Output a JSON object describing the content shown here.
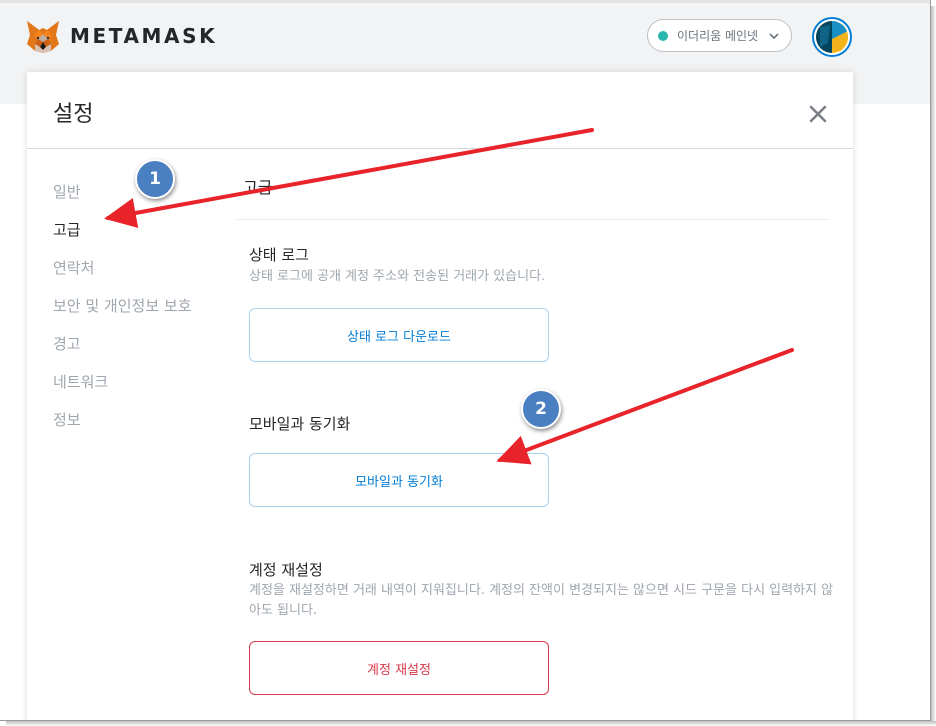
{
  "header": {
    "brand": "METAMASK",
    "network": "이더리움 메인넷"
  },
  "settings": {
    "title": "설정",
    "sidebar": [
      {
        "label": "일반",
        "active": false
      },
      {
        "label": "고급",
        "active": true
      },
      {
        "label": "연락처",
        "active": false
      },
      {
        "label": "보안 및 개인정보 보호",
        "active": false
      },
      {
        "label": "경고",
        "active": false
      },
      {
        "label": "네트워크",
        "active": false
      },
      {
        "label": "정보",
        "active": false
      }
    ],
    "section_title": "고급",
    "state_logs": {
      "label": "상태 로그",
      "description": "상태 로그에 공개 계정 주소와 전송된 거래가 있습니다.",
      "button": "상태 로그 다운로드"
    },
    "sync_mobile": {
      "label": "모바일과 동기화",
      "button": "모바일과 동기화"
    },
    "reset_account": {
      "label": "계정 재설정",
      "description": "계정을 재설정하면 거래 내역이 지워집니다. 계정의 잔액이 변경되지는 않으면 시드 구문을 다시 입력하지 않아도 됩니다.",
      "button": "계정 재설정"
    }
  },
  "annotations": {
    "step1": "1",
    "step2": "2",
    "arrow_color": "#e8232a",
    "badge_color": "#4a80c2"
  },
  "colors": {
    "accent": "#037dd6",
    "danger": "#d73a49",
    "network_dot": "#29b6af"
  }
}
